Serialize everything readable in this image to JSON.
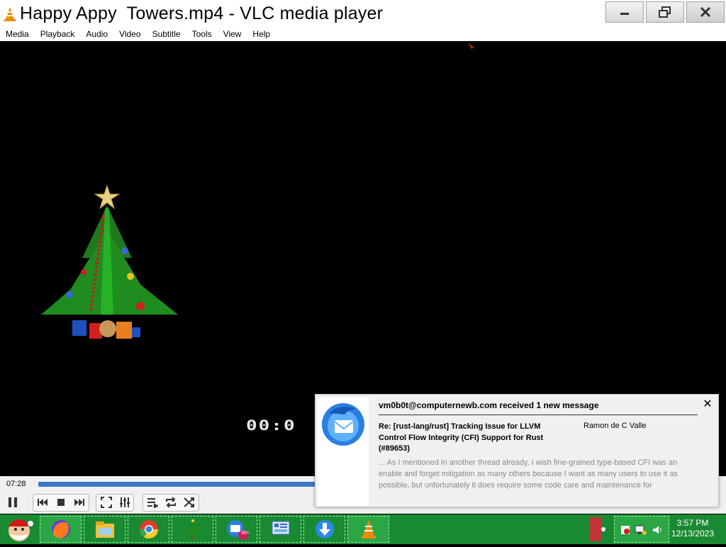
{
  "window": {
    "title": "Happy Appy  Towers.mp4 - VLC media player",
    "app_icon": "vlc-cone-icon"
  },
  "menu": [
    "Media",
    "Playback",
    "Audio",
    "Video",
    "Subtitle",
    "Tools",
    "View",
    "Help"
  ],
  "video": {
    "overlay_text": "00:0"
  },
  "player": {
    "time_elapsed": "07:28",
    "accent_color": "#3a79c6"
  },
  "notification": {
    "header": "vm0b0t@computernewb.com received 1 new message",
    "subject": "Re: [rust-lang/rust] Tracking Issue for LLVM Control Flow Integrity (CFI) Support for Rust (#89653)",
    "sender": "Ramon de C Valle",
    "preview": "... As I mentioned in another thread already, I wish fine-grained type-based CFI was an enable and forget mitigation as many others because I want as many users to use it as possible, but unfortunately it does require some code care and maintenance for",
    "close_label": "✕",
    "icon": "thunderbird-icon"
  },
  "taskbar": {
    "badge": "99+",
    "time": "3:57 PM",
    "date": "12/13/2023",
    "color": "#1a8a32"
  }
}
